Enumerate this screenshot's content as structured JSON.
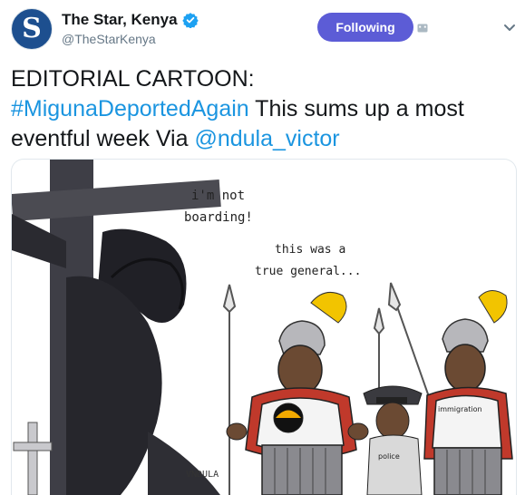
{
  "account": {
    "display_name": "The Star, Kenya",
    "handle": "@TheStarKenya",
    "avatar_letter": "S",
    "verified": true
  },
  "follow_button": {
    "label": "Following"
  },
  "tweet": {
    "line1": "EDITORIAL CARTOON:",
    "hashtag": "#MigunaDeportedAgain",
    "text_mid": " This sums up a most eventful week Via ",
    "mention": "@ndula_victor"
  },
  "cartoon": {
    "speech_1": [
      "i'm not",
      "boarding!"
    ],
    "speech_2": [
      "this was a",
      "true general..."
    ],
    "sash_1": "immigration",
    "sash_2": "police",
    "signature": "VNDULA"
  },
  "colors": {
    "accent": "#1b95e0",
    "follow_bg": "#5c5cd6",
    "verified": "#1da1f2",
    "brand": "#1d4f8f"
  },
  "icons": [
    "verified-badge-icon",
    "direct-message-icon",
    "chevron-down-icon"
  ]
}
